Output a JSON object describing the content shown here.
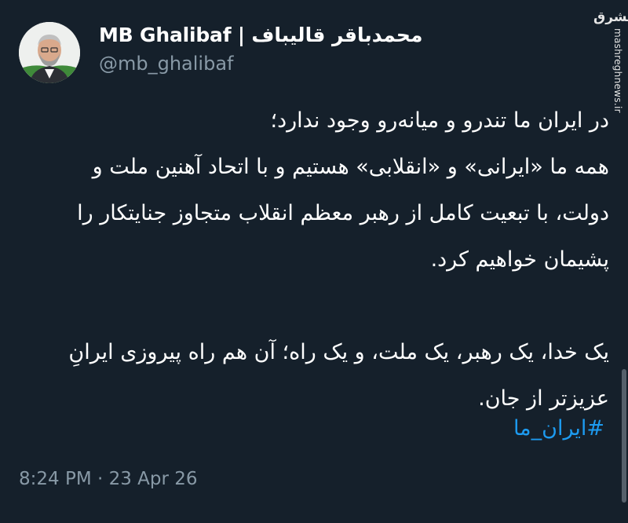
{
  "author": {
    "display_name": "MB Ghalibaf | محمدباقر قالیباف",
    "handle": "@mb_ghalibaf",
    "avatar_icon": "user-avatar"
  },
  "watermark": {
    "logo": "مشرق",
    "url": "mashreghnews.ir"
  },
  "tweet": {
    "lines": [
      "در ایران ما تندرو و میانه‌رو وجود ندارد؛",
      "همه ما «ایرانی» و «انقلابی» هستیم و با اتحاد آهنین ملت و",
      "دولت، با تبعیت کامل از رهبر معظم انقلاب متجاوز جنایتکار را",
      "پشیمان خواهیم کرد.",
      "یک خدا، یک رهبر، یک ملت، و یک راه؛ آن هم راه پیروزی ایرانِ",
      "عزیزتر از جان."
    ],
    "hashtag": "#ایران_ما",
    "timestamp": "8:24 PM · 23 Apr 26"
  },
  "colors": {
    "background": "#15202b",
    "text": "#ffffff",
    "secondary": "#8899a6",
    "link": "#1d9bf0"
  }
}
